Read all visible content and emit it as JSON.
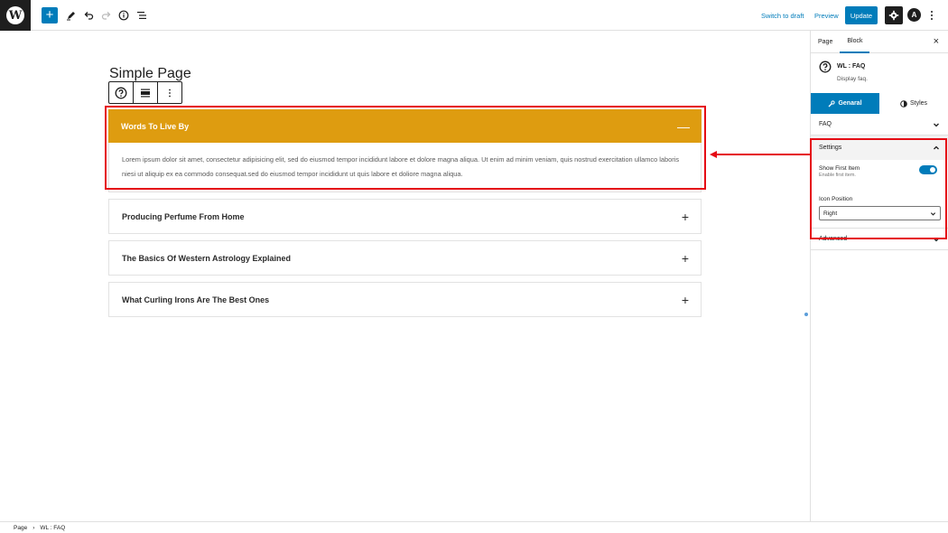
{
  "toolbar": {
    "switch_to_draft": "Switch to draft",
    "preview": "Preview",
    "update": "Update",
    "astra_letter": "A"
  },
  "page_title": "Simple Page",
  "faq": {
    "items": [
      {
        "title": "Words To Live By",
        "open": true,
        "toggle": "—",
        "body": "Lorem ipsum dolor sit amet, consectetur adipisicing elit, sed do eiusmod tempor incididunt labore et dolore magna aliqua. Ut enim ad minim veniam, quis nostrud exercitation ullamco laboris niesi ut aliquip ex ea commodo consequat.sed do eiusmod tempor incididunt ut quis labore et doliore magna aliqua."
      },
      {
        "title": "Producing Perfume From Home",
        "open": false,
        "toggle": "+"
      },
      {
        "title": "The Basics Of Western Astrology Explained",
        "open": false,
        "toggle": "+"
      },
      {
        "title": "What Curling Irons Are The Best Ones",
        "open": false,
        "toggle": "+"
      }
    ],
    "accent_color": "#de9c10"
  },
  "sidebar": {
    "tabs": [
      "Page",
      "Block"
    ],
    "active_tab": "Block",
    "close": "×",
    "block_name": "WL : FAQ",
    "block_desc": "Display faq.",
    "sub_tabs": [
      "Genaral",
      "Styles"
    ],
    "active_sub_tab": "Genaral",
    "panels": {
      "faq": "FAQ",
      "settings": "Settings",
      "advanced": "Advanced"
    },
    "settings": {
      "show_first_item_label": "Show First Item",
      "show_first_item_help": "Enable first item.",
      "show_first_item_on": true,
      "icon_position_label": "Icon Position",
      "icon_position_value": "Right"
    }
  },
  "breadcrumb": {
    "items": [
      "Page",
      "WL : FAQ"
    ],
    "separator": "›"
  },
  "colors": {
    "wp_blue": "#007cba",
    "highlight_red": "#e50914"
  }
}
